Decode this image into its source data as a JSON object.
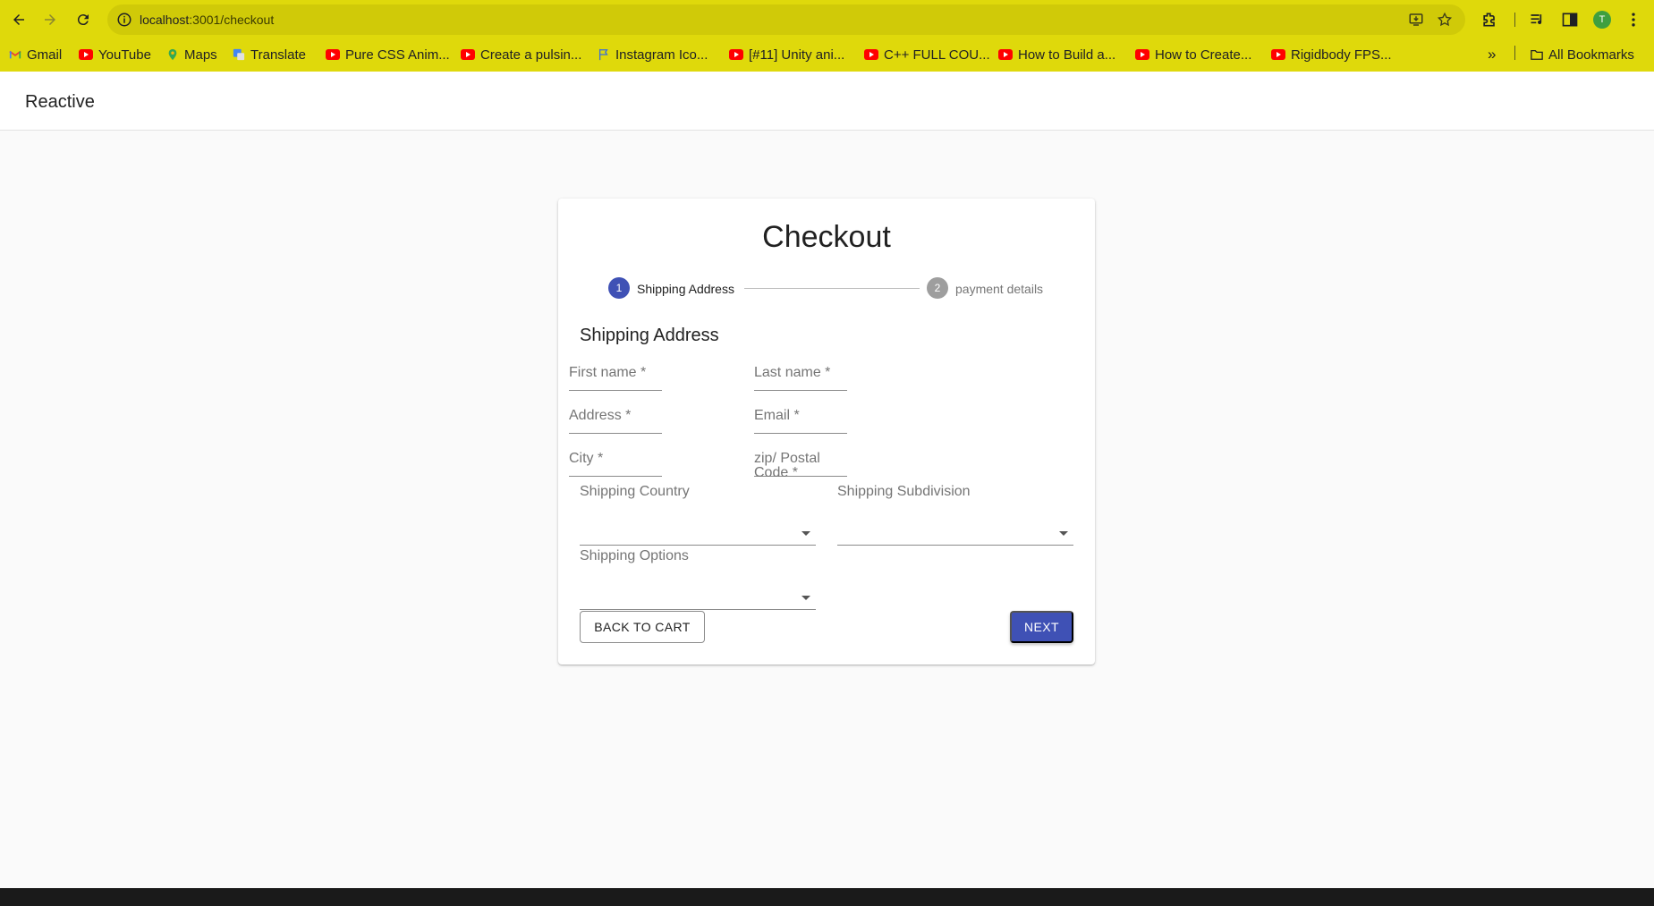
{
  "browser": {
    "url_host": "localhost",
    "url_path": ":3001/checkout",
    "profile_initial": "T",
    "bookmarks": [
      {
        "label": "Gmail",
        "icon": "gmail-icon"
      },
      {
        "label": "YouTube",
        "icon": "youtube-icon"
      },
      {
        "label": "Maps",
        "icon": "maps-icon"
      },
      {
        "label": "Translate",
        "icon": "translate-icon"
      },
      {
        "label": "Pure CSS Anim...",
        "icon": "youtube-icon"
      },
      {
        "label": "Create a pulsin...",
        "icon": "youtube-icon"
      },
      {
        "label": "Instagram Ico...",
        "icon": "flag-icon"
      },
      {
        "label": "[#11] Unity ani...",
        "icon": "youtube-icon"
      },
      {
        "label": "C++ FULL COU...",
        "icon": "youtube-icon"
      },
      {
        "label": "How to Build a...",
        "icon": "youtube-icon"
      },
      {
        "label": "How to Create...",
        "icon": "youtube-icon"
      },
      {
        "label": "Rigidbody FPS...",
        "icon": "youtube-icon"
      }
    ],
    "all_bookmarks": "All Bookmarks",
    "chrome_color": "#dfd90b"
  },
  "app": {
    "brand": "Reactive"
  },
  "checkout": {
    "title": "Checkout",
    "steps": [
      {
        "number": "1",
        "label": "Shipping Address",
        "active": true
      },
      {
        "number": "2",
        "label": "payment details",
        "active": false
      }
    ],
    "section_title": "Shipping Address",
    "fields": {
      "first_name": "First name *",
      "last_name": "Last name *",
      "address": "Address *",
      "email": "Email *",
      "city": "City *",
      "zip_line1": "zip/ Postal",
      "zip_line2": "Code *"
    },
    "selects": {
      "country": "Shipping Country",
      "subdivision": "Shipping Subdivision",
      "options": "Shipping Options"
    },
    "back_button": "BACK TO CART",
    "next_button": "NEXT",
    "accent_color": "#3f51b5"
  }
}
